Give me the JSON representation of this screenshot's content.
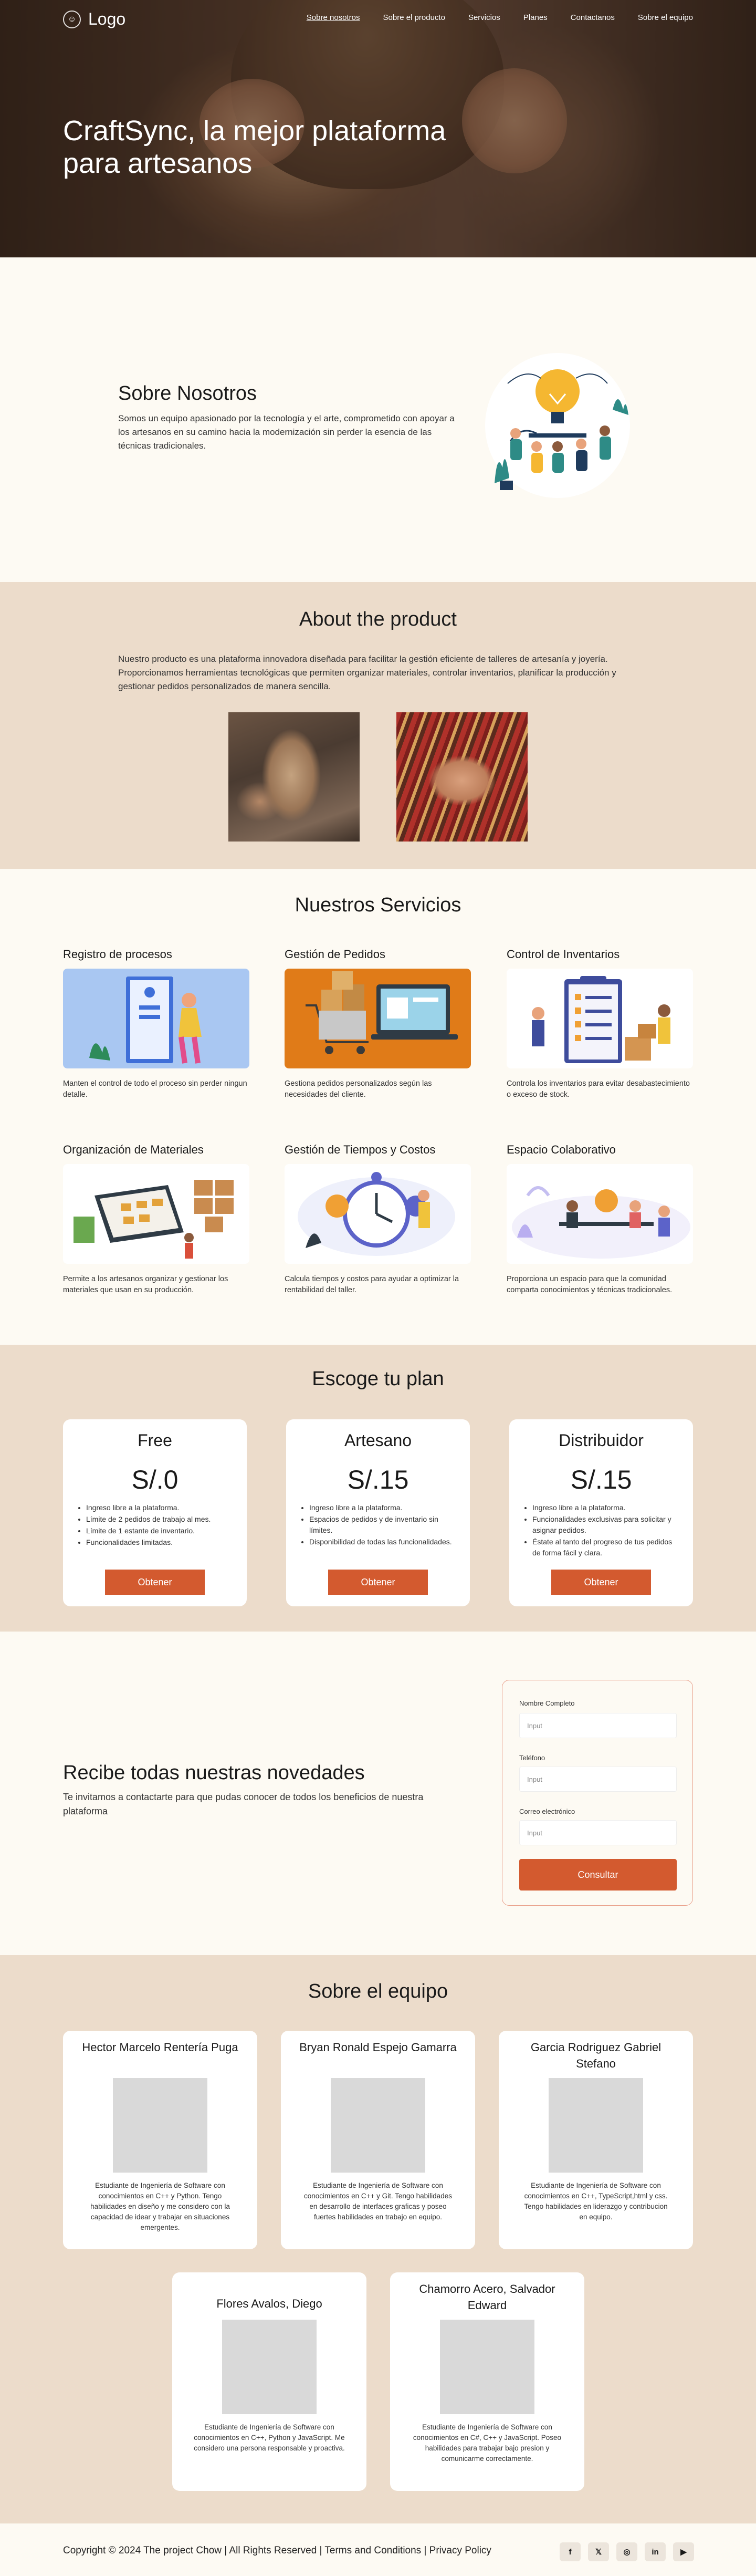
{
  "header": {
    "logo_text": "Logo",
    "nav": [
      "Sobre nosotros",
      "Sobre el producto",
      "Servicios",
      "Planes",
      "Contactanos",
      "Sobre el equipo"
    ],
    "hero_title": "CraftSync, la mejor plataforma para artesanos"
  },
  "about": {
    "title": "Sobre Nosotros",
    "text": "Somos un equipo apasionado por la tecnología y el arte, comprometido con apoyar a los artesanos en su camino hacia la modernización sin perder la esencia de las técnicas tradicionales."
  },
  "product": {
    "title": "About the product",
    "text": "Nuestro producto es una plataforma innovadora diseñada para facilitar la gestión eficiente de talleres de artesanía y joyería. Proporcionamos herramientas tecnológicas que permiten organizar materiales, controlar inventarios, planificar la producción y gestionar pedidos personalizados de manera sencilla."
  },
  "services": {
    "title": "Nuestros Servicios",
    "items": [
      {
        "title": "Registro de procesos",
        "text": "Manten el control de todo el proceso sin perder ningun detalle."
      },
      {
        "title": "Gestión de Pedidos",
        "text": "Gestiona pedidos personalizados según las necesidades del cliente."
      },
      {
        "title": "Control de Inventarios",
        "text": "Controla los inventarios para evitar desabastecimiento o exceso de stock."
      },
      {
        "title": "Organización de Materiales",
        "text": "Permite a los artesanos organizar y gestionar los materiales que usan en su producción."
      },
      {
        "title": "Gestión de Tiempos y Costos",
        "text": "Calcula tiempos y costos para ayudar a optimizar la rentabilidad del taller."
      },
      {
        "title": "Espacio Colaborativo",
        "text": "Proporciona un espacio para que la comunidad comparta conocimientos y técnicas tradicionales."
      }
    ]
  },
  "plans": {
    "title": "Escoge tu plan",
    "items": [
      {
        "name": "Free",
        "price": "S/.0",
        "features": [
          "Ingreso libre a la plataforma.",
          "Límite de 2 pedidos de trabajo al mes.",
          "Límite de 1 estante de inventario.",
          "Funcionalidades limitadas."
        ],
        "button": "Obtener"
      },
      {
        "name": "Artesano",
        "price": "S/.15",
        "features": [
          "Ingreso libre a la plataforma.",
          "Espacios de pedidos y de inventario sin límites.",
          "Disponibilidad de todas las funcionalidades."
        ],
        "button": "Obtener"
      },
      {
        "name": "Distribuidor",
        "price": "S/.15",
        "features": [
          "Ingreso libre a la plataforma.",
          "Funcionalidades exclusivas para solicitar y asignar pedidos.",
          "Éstate al tanto del progreso de tus pedidos de forma fácil y clara."
        ],
        "button": "Obtener"
      }
    ]
  },
  "contact": {
    "title": "Recibe todas nuestras novedades",
    "text": "Te invitamos a contactarte para que pudas conocer de todos los beneficios de nuestra plataforma",
    "fields": [
      {
        "label": "Nombre Completo",
        "placeholder": "Input"
      },
      {
        "label": "Teléfono",
        "placeholder": "Input"
      },
      {
        "label": "Correo electrónico",
        "placeholder": "Input"
      }
    ],
    "button": "Consultar"
  },
  "team": {
    "title": "Sobre el equipo",
    "members": [
      {
        "name": "Hector Marcelo Rentería Puga",
        "text": "Estudiante de Ingeniería de Software con conocimientos en C++ y Python. Tengo habilidades en diseño y me considero con la capacidad de idear y trabajar en situaciones emergentes."
      },
      {
        "name": "Bryan Ronald Espejo Gamarra",
        "text": "Estudiante de Ingeniería de Software con conocimientos en C++ y Git. Tengo habilidades en desarrollo de interfaces graficas y poseo fuertes habilidades en trabajo en equipo."
      },
      {
        "name": "Garcia Rodriguez Gabriel Stefano",
        "text": "Estudiante de Ingeniería de Software con conocimientos en C++, TypeScript,html y css. Tengo habilidades en liderazgo y contribucion en equipo."
      },
      {
        "name": "Flores Avalos, Diego",
        "text": "Estudiante de Ingeniería de Software con conocimientos en C++, Python y JavaScript. Me considero una persona responsable y proactiva."
      },
      {
        "name": "Chamorro Acero, Salvador Edward",
        "text": "Estudiante de Ingeniería de Software con conocimientos en C#, C++ y JavaScript. Poseo habilidades para trabajar bajo presion y comunicarme correctamente."
      }
    ]
  },
  "footer": {
    "copyright": "Copyright © 2024 The project Chow | All Rights Reserved | Terms and Conditions | Privacy Policy",
    "socials": [
      "facebook-icon",
      "twitter-icon",
      "instagram-icon",
      "linkedin-icon",
      "youtube-icon"
    ],
    "social_glyphs": [
      "f",
      "𝕏",
      "◎",
      "in",
      "▶"
    ]
  },
  "colors": {
    "accent": "#d35a2f",
    "beige": "#ecdccb",
    "cream": "#fdfaf3"
  }
}
